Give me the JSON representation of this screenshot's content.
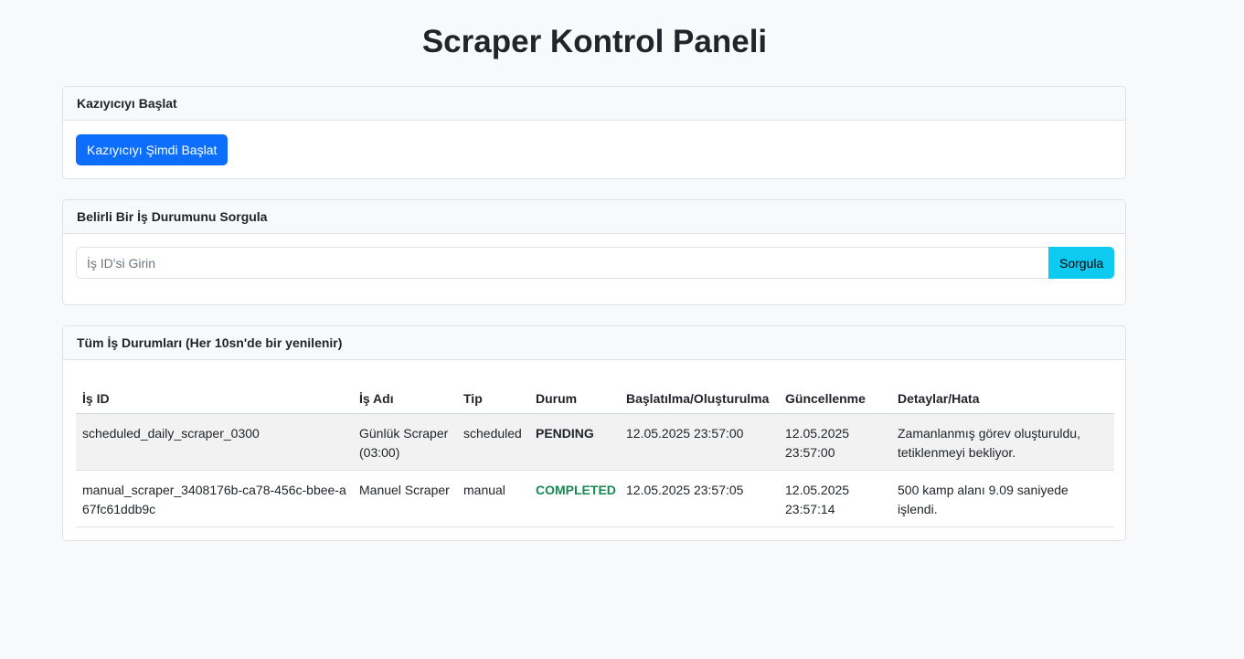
{
  "page": {
    "title": "Scraper Kontrol Paneli"
  },
  "start_card": {
    "header": "Kazıyıcıyı Başlat",
    "button_label": "Kazıyıcıyı Şimdi Başlat"
  },
  "query_card": {
    "header": "Belirli Bir İş Durumunu Sorgula",
    "input_placeholder": "İş ID'si Girin",
    "input_value": "",
    "button_label": "Sorgula"
  },
  "jobs_card": {
    "header": "Tüm İş Durumları (Her 10sn'de bir yenilenir)",
    "columns": [
      "İş ID",
      "İş Adı",
      "Tip",
      "Durum",
      "Başlatılma/Oluşturulma",
      "Güncellenme",
      "Detaylar/Hata"
    ],
    "rows": [
      {
        "job_id": "scheduled_daily_scraper_0300",
        "job_name": "Günlük Scraper (03:00)",
        "type": "scheduled",
        "status": "PENDING",
        "started": "12.05.2025 23:57:00",
        "updated": "12.05.2025 23:57:00",
        "details": "Zamanlanmış görev oluşturuldu, tetiklenmeyi bekliyor."
      },
      {
        "job_id": "manual_scraper_3408176b-ca78-456c-bbee-a67fc61ddb9c",
        "job_name": "Manuel Scraper",
        "type": "manual",
        "status": "COMPLETED",
        "started": "12.05.2025 23:57:05",
        "updated": "12.05.2025 23:57:14",
        "details": "500 kamp alanı 9.09 saniyede işlendi."
      }
    ]
  },
  "colors": {
    "primary": "#0d6efd",
    "info": "#0dcaf0",
    "success": "#198754",
    "page_bg": "#f8f9fa"
  }
}
